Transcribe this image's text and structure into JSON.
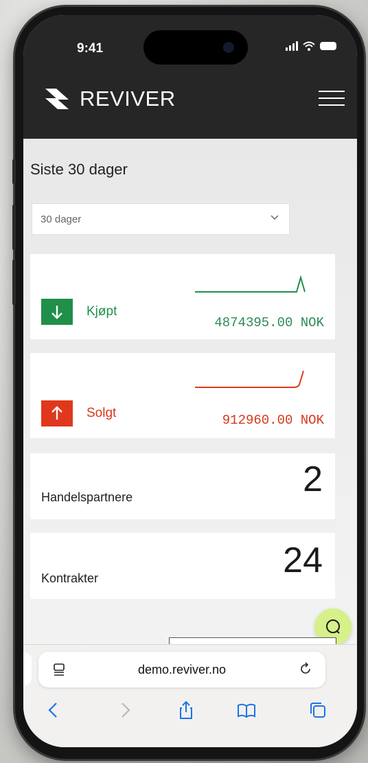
{
  "status_bar": {
    "time": "9:41"
  },
  "header": {
    "brand": "REVIVER"
  },
  "period": {
    "title": "Siste 30 dager",
    "selected": "30 dager"
  },
  "cards": {
    "bought": {
      "label": "Kjøpt",
      "amount": "4874395.00 NOK",
      "color": "#1f8f4a"
    },
    "sold": {
      "label": "Solgt",
      "amount": "912960.00 NOK",
      "color": "#e0381c"
    },
    "partners": {
      "label": "Handelspartnere",
      "value": "2"
    },
    "contracts": {
      "label": "Kontrakter",
      "value": "24"
    }
  },
  "browser": {
    "url": "demo.reviver.no"
  },
  "colors": {
    "header_bg": "#262626",
    "chat_button": "#d6f08a",
    "browser_accent": "#1a73e8"
  }
}
